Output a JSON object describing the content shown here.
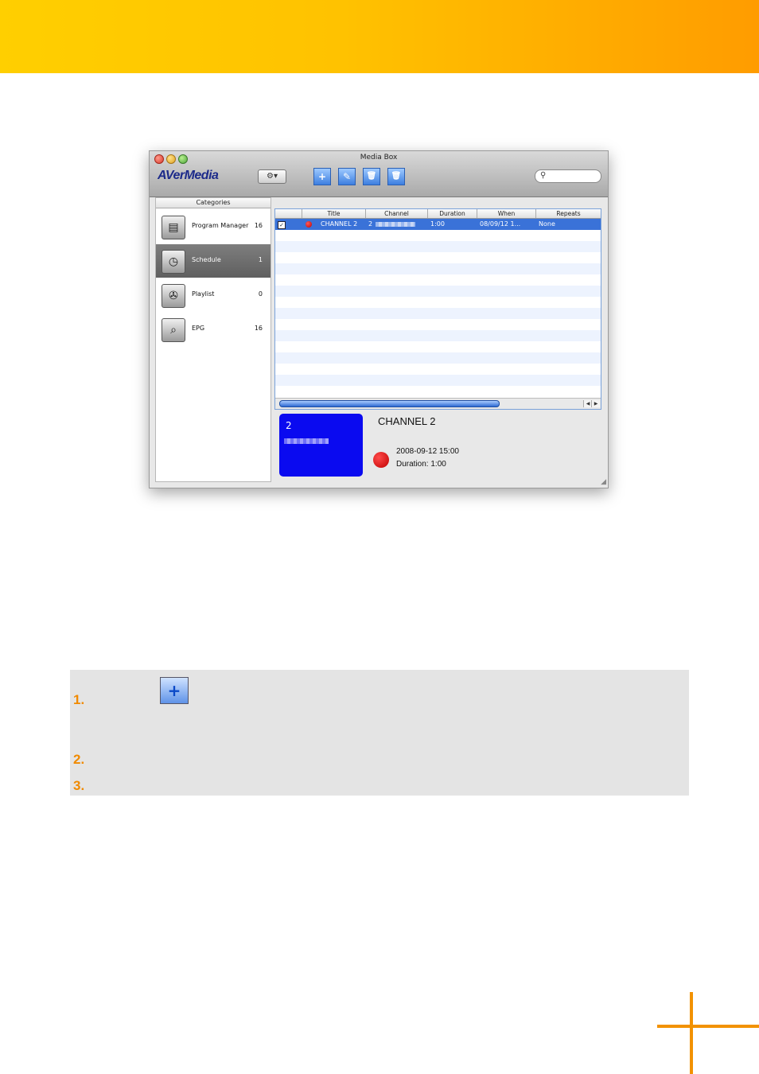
{
  "window": {
    "title": "Media Box",
    "logo": "AVerMedia",
    "gear_label": "⚙▾",
    "toolbar": [
      {
        "name": "add-schedule-button",
        "glyph": "+"
      },
      {
        "name": "edit-schedule-button",
        "glyph": "✎"
      },
      {
        "name": "delete-schedule-button",
        "glyph": "🗑"
      },
      {
        "name": "delete-all-schedule-button",
        "glyph": "🗑"
      }
    ]
  },
  "sidebar": {
    "header": "Categories",
    "items": [
      {
        "label": "Program Manager",
        "count": "16",
        "icon": "film-icon",
        "selected": false
      },
      {
        "label": "Schedule",
        "count": "1",
        "icon": "clock-icon",
        "selected": true
      },
      {
        "label": "Playlist",
        "count": "0",
        "icon": "film-reel-icon",
        "selected": false
      },
      {
        "label": "EPG",
        "count": "16",
        "icon": "magnifier-icon",
        "selected": false
      }
    ]
  },
  "table": {
    "columns": [
      "",
      "Title",
      "Channel",
      "Duration",
      "When",
      "Repeats"
    ],
    "rows": [
      {
        "checked": true,
        "title": "CHANNEL 2",
        "channel": "2",
        "duration": "1:00",
        "when": "08/09/12 1...",
        "repeats": "None"
      }
    ]
  },
  "detail": {
    "preview_channel": "2",
    "channel_name": "CHANNEL 2",
    "datetime": "2008-09-12 15:00",
    "duration": "Duration: 1:00"
  },
  "steps": [
    {
      "number": "1."
    },
    {
      "number": "2."
    },
    {
      "number": "3."
    }
  ],
  "colors": {
    "accent": "#f29200",
    "selection": "#3a72d8",
    "preview": "#0a0af0"
  }
}
